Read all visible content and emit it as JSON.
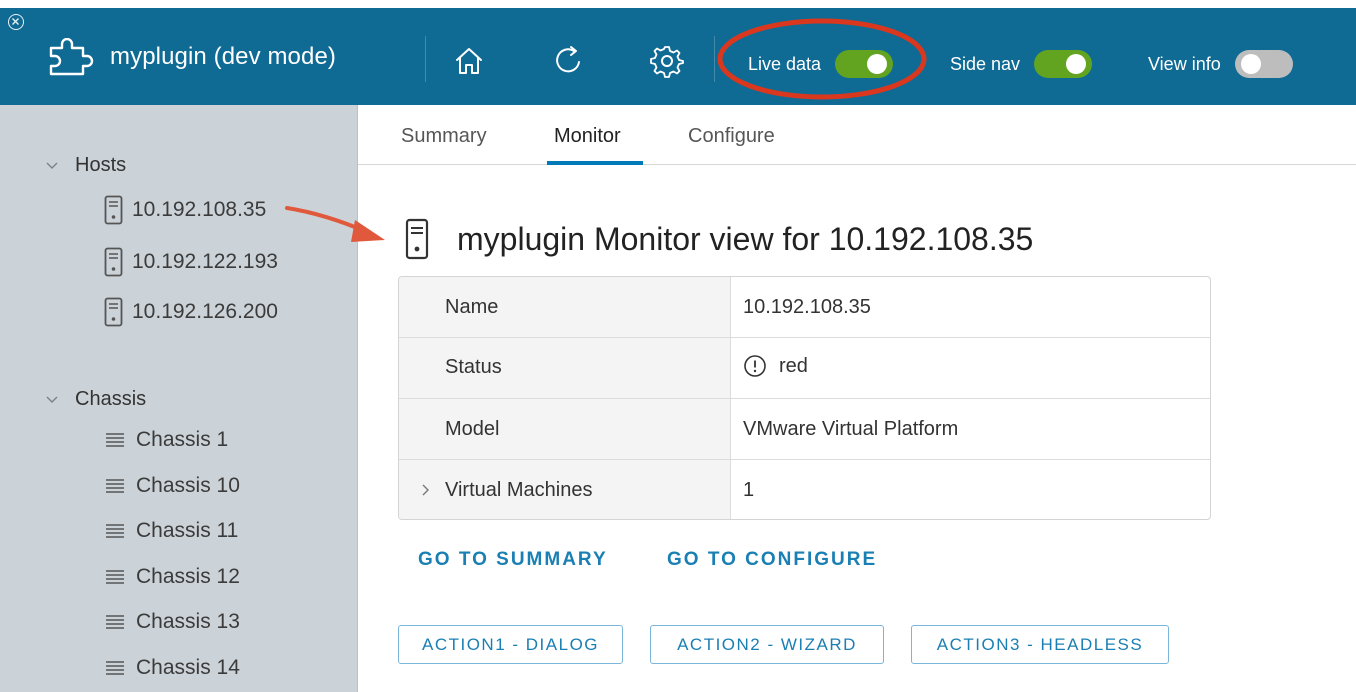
{
  "app": {
    "title": "myplugin (dev mode)"
  },
  "toolbar": {
    "toggles": [
      {
        "label": "Live data",
        "on": true
      },
      {
        "label": "Side nav",
        "on": true
      },
      {
        "label": "View info",
        "on": false
      }
    ]
  },
  "sidebar": {
    "groups": [
      {
        "label": "Hosts",
        "items": [
          "10.192.108.35",
          "10.192.122.193",
          "10.192.126.200"
        ]
      },
      {
        "label": "Chassis",
        "items": [
          "Chassis 1",
          "Chassis 10",
          "Chassis 11",
          "Chassis 12",
          "Chassis 13",
          "Chassis 14"
        ]
      }
    ]
  },
  "tabs": [
    {
      "label": "Summary",
      "active": false
    },
    {
      "label": "Monitor",
      "active": true
    },
    {
      "label": "Configure",
      "active": false
    }
  ],
  "main": {
    "heading": "myplugin Monitor view for 10.192.108.35",
    "properties": [
      {
        "label": "Name",
        "value": "10.192.108.35"
      },
      {
        "label": "Status",
        "value": "red"
      },
      {
        "label": "Model",
        "value": "VMware Virtual Platform"
      },
      {
        "label": "Virtual Machines",
        "value": "1"
      }
    ],
    "links": [
      "GO TO SUMMARY",
      "GO TO CONFIGURE"
    ],
    "actions": [
      "ACTION1 - DIALOG",
      "ACTION2 - WIZARD",
      "ACTION3 - HEADLESS"
    ]
  },
  "colors": {
    "header_bg": "#0f6a94",
    "toggle_on": "#62a420",
    "toggle_off": "#bdbdbd",
    "sidebar_bg": "#ccd3d8",
    "accent": "#0079b8",
    "annotation_red": "#d9381e"
  }
}
